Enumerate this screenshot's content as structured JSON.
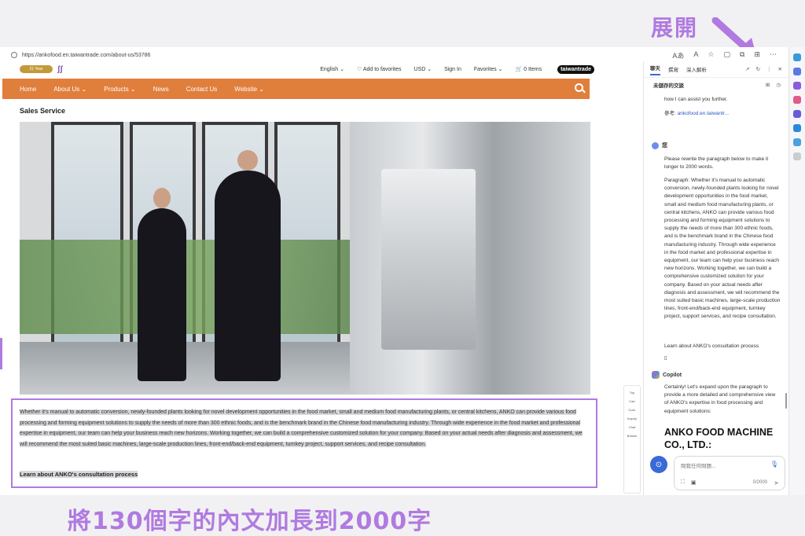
{
  "annotations": {
    "expand": "展開",
    "caption": "將130個字的內文加長到2000字"
  },
  "browser": {
    "url": "https://ankofood.en.taiwantrade.com/about-us/53786",
    "toolbar_icons": [
      "read-aloud-icon",
      "font-icon",
      "favorite-star-icon",
      "split-screen-icon",
      "extensions-icon",
      "collections-icon",
      "more-icon"
    ]
  },
  "site": {
    "logo_badge": "21 Year",
    "top_links": [
      "English ⌄",
      "♡ Add to favorites",
      "USD ⌄",
      "Sign In",
      "Favorites ⌄",
      "🛒 0 Items"
    ],
    "tw_logo": "taiwantrade",
    "nav": [
      "Home",
      "About Us ⌄",
      "Products ⌄",
      "News",
      "Contact Us",
      "Website ⌄"
    ],
    "section_title": "Sales Service",
    "paragraph": "Whether it's manual to automatic conversion, newly-founded plants looking for novel development opportunities in the food market, small and medium food manufacturing plants, or central kitchens, ANKO can provide various food processing and forming equipment solutions to supply the needs of more than 300 ethnic foods, and is the benchmark brand in the Chinese food manufacturing industry. Through wide experience in the food market and professional expertise in equipment, our team can help your business reach new horizons. Working together, we can build a comprehensive customized solution for your company. Based on your actual needs after diagnosis and assessment, we will recommend the most suited basic machines, large-scale production lines, front-end/back-end equipment, turnkey project, support services, and recipe consultation.",
    "learn_link": "Learn about ANKO's consultation process",
    "side_tools": [
      "Top",
      "Cart",
      "Cust.",
      "Inquiry",
      "Chat",
      "Bottom"
    ]
  },
  "copilot": {
    "tabs": [
      "聊天",
      "撰寫",
      "深入解析"
    ],
    "header": "未儲存的交談",
    "prev_tail": "how I can assist you further.",
    "ref_label": "參考:",
    "ref_link": "ankofood.en.taiwantr...",
    "user_name": "您",
    "user_request": "Please rewrite the paragraph below to make it longer to 2000 words.",
    "user_paragraph": "Paragraph: Whether it's manual to automatic conversion, newly-founded plants looking for novel development opportunities in the food market, small and medium food manufacturing plants, or central kitchens, ANKO can provide various food processing and forming equipment solutions to supply the needs of more than 300 ethnic foods, and is the benchmark brand in the Chinese food manufacturing industry. Through wide experience in the food market and professional expertise in equipment, our team can help your business reach new horizons. Working together, we can build a comprehensive customized solution for your company. Based on your actual needs after diagnosis and assessment, we will recommend the most suited basic machines, large-scale production lines, front-end/back-end equipment, turnkey project, support services, and recipe consultation.",
    "user_learn": "Learn about ANKO's consultation process",
    "bot_name": "Copilot",
    "bot_reply": "Certainly! Let's expand upon the paragraph to provide a more detailed and comprehensive view of ANKO's expertise in food processing and equipment solutions:",
    "bot_heading": "ANKO FOOD MACHINE CO., LTD.:",
    "input_placeholder": "問我任何問題...",
    "char_count": "0/2000"
  }
}
